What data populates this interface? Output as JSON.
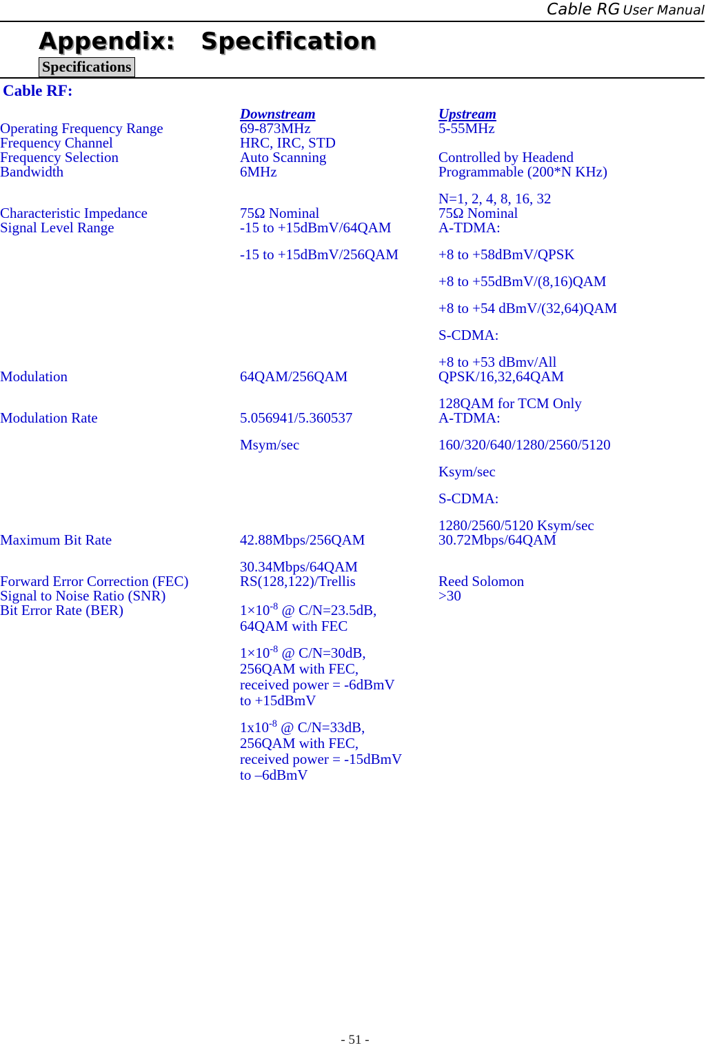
{
  "header": {
    "brand": "Cable RG",
    "subtitle": "User Manual"
  },
  "title": {
    "appendix": "Appendix:   Specification",
    "tag": "Specifications"
  },
  "section": {
    "heading": "Cable RF:"
  },
  "table": {
    "columns": {
      "label": "",
      "downstream": "Downstream",
      "upstream": "Upstream"
    },
    "rows": [
      {
        "label": "Operating Frequency Range",
        "downstream": [
          "69-873MHz"
        ],
        "upstream": [
          "5-55MHz"
        ]
      },
      {
        "label": "Frequency Channel",
        "downstream": [
          "HRC, IRC, STD"
        ],
        "upstream": []
      },
      {
        "label": "Frequency Selection",
        "downstream": [
          "Auto Scanning"
        ],
        "upstream": [
          "Controlled by Headend"
        ]
      },
      {
        "label": "Bandwidth",
        "downstream": [
          "6MHz"
        ],
        "upstream": [
          "Programmable (200*N KHz)",
          "N=1, 2, 4, 8, 16, 32"
        ]
      },
      {
        "label": "Characteristic Impedance",
        "downstream": [
          "75Ω Nominal"
        ],
        "upstream": [
          "75Ω Nominal"
        ]
      },
      {
        "label": "Signal Level Range",
        "downstream": [
          "-15 to +15dBmV/64QAM",
          "-15 to +15dBmV/256QAM"
        ],
        "upstream": [
          "A-TDMA:",
          "+8 to +58dBmV/QPSK",
          "+8 to +55dBmV/(8,16)QAM",
          "+8 to +54 dBmV/(32,64)QAM",
          "S-CDMA:",
          "+8 to +53 dBmv/All"
        ]
      },
      {
        "label": "Modulation",
        "downstream": [
          "64QAM/256QAM"
        ],
        "upstream": [
          "QPSK/16,32,64QAM",
          "128QAM for TCM Only"
        ]
      },
      {
        "label": "Modulation Rate",
        "downstream": [
          "5.056941/5.360537",
          "Msym/sec"
        ],
        "upstream": [
          "A-TDMA:",
          "160/320/640/1280/2560/5120",
          "Ksym/sec",
          "S-CDMA:",
          "1280/2560/5120 Ksym/sec"
        ]
      },
      {
        "label": "Maximum Bit Rate",
        "downstream": [
          "42.88Mbps/256QAM",
          "30.34Mbps/64QAM"
        ],
        "upstream": [
          "30.72Mbps/64QAM"
        ]
      },
      {
        "label": "Forward Error Correction (FEC)",
        "downstream": [
          "RS(128,122)/Trellis"
        ],
        "upstream": [
          "Reed Solomon"
        ]
      },
      {
        "label": "Signal to Noise Ratio (SNR)",
        "downstream": [],
        "upstream": [
          ">30"
        ]
      }
    ],
    "ber": {
      "label": "Bit Error Rate (BER)",
      "blocks": [
        {
          "prefix": "1×10",
          "exponent": "-8",
          "suffix": " @ C/N=23.5dB,",
          "lines": [
            "64QAM with FEC"
          ]
        },
        {
          "prefix": "1×10",
          "exponent": "-8",
          "suffix": " @ C/N=30dB,",
          "lines": [
            "256QAM with FEC,",
            "received power = -6dBmV",
            "to +15dBmV"
          ]
        },
        {
          "prefix": "1x10",
          "exponent": "-8",
          "suffix": " @ C/N=33dB,",
          "lines": [
            "256QAM with FEC,",
            "received power = -15dBmV",
            "to –6dBmV"
          ]
        }
      ]
    }
  },
  "footer": {
    "page": "- 51 -"
  },
  "colors": {
    "text_blue": "#0000cc",
    "text_black": "#000000",
    "tag_background": "#d3d3d3"
  }
}
